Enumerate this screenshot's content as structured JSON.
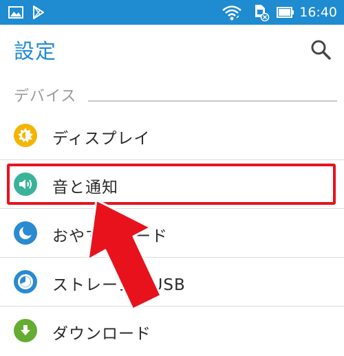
{
  "status_bar": {
    "time": "16:40",
    "icons": [
      "gallery-icon",
      "play-store-icon",
      "wifi-icon",
      "no-sim-icon",
      "battery-icon"
    ],
    "background": "#1f8bd0"
  },
  "header": {
    "title": "設定",
    "search_icon": "search-icon",
    "accent": "#1f8bd0"
  },
  "section": {
    "title": "デバイス"
  },
  "settings_items": [
    {
      "label": "ディスプレイ",
      "icon": "brightness-icon",
      "color": "#f5b400"
    },
    {
      "label": "音と通知",
      "icon": "volume-icon",
      "color": "#3bb39a"
    },
    {
      "label": "おやすみモード",
      "icon": "moon-icon",
      "color": "#2a8bd0"
    },
    {
      "label": "ストレージとUSB",
      "icon": "storage-icon",
      "color": "#2a8bd0"
    },
    {
      "label": "ダウンロード",
      "icon": "download-icon",
      "color": "#63ad32"
    }
  ],
  "highlight": {
    "color": "#e8121c",
    "target": "音と通知"
  }
}
